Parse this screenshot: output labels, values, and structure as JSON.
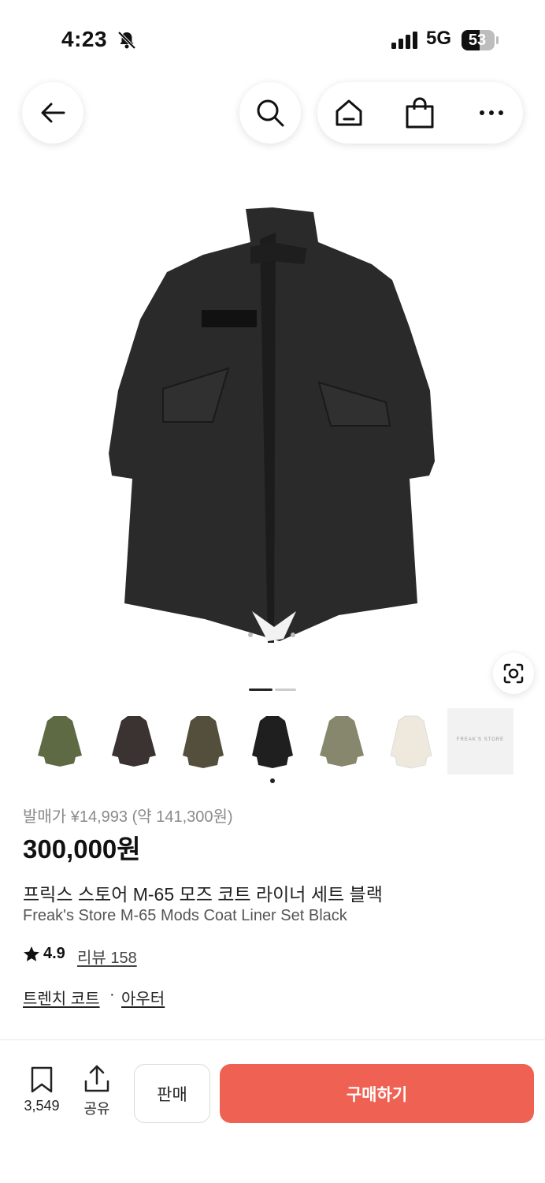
{
  "status_bar": {
    "time": "4:23",
    "network": "5G",
    "battery": "53"
  },
  "nav": {
    "icons": [
      "back-arrow-icon",
      "search-icon",
      "home-icon",
      "shopping-bag-icon",
      "more-icon"
    ]
  },
  "gallery": {
    "current_index": 0,
    "total_pages": 2,
    "thumbnail_count": 7,
    "last_thumb_text": "FREAK'S STORE"
  },
  "product": {
    "release_price": "발매가 ¥14,993 (약 141,300원)",
    "price": "300,000원",
    "title_ko": "프릭스 스토어 M-65 모즈 코트 라이너 세트 블랙",
    "title_en": "Freak's Store M-65 Mods Coat Liner Set Black",
    "rating": "4.9",
    "review_label": "리뷰 158",
    "category_1": "트렌치 코트",
    "category_sep": "·",
    "category_2": "아우터"
  },
  "bottom_bar": {
    "bookmark_count": "3,549",
    "share_label": "공유",
    "sell_label": "판매",
    "buy_label": "구매하기",
    "buy_color": "#ef6253"
  }
}
